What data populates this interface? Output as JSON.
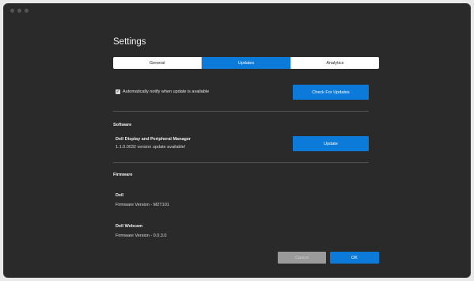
{
  "dialog": {
    "title": "Settings"
  },
  "tabs": [
    {
      "label": "General",
      "active": false
    },
    {
      "label": "Updates",
      "active": true
    },
    {
      "label": "Analytics",
      "active": false
    }
  ],
  "updates": {
    "auto_notify_label": "Automatically notify when update is available",
    "auto_notify_checked": true,
    "check_button": "Check For Updates"
  },
  "software": {
    "heading": "Software",
    "app_name": "Dell Display and Peripheral Manager",
    "status": "1.1.0.0032 version update available!",
    "update_button": "Update"
  },
  "firmware": {
    "heading": "Firmware",
    "devices": [
      {
        "name": "Dell",
        "version": "Firmware Version - M2T101"
      },
      {
        "name": "Dell Webcam",
        "version": "Firmware Version - 0.0.3.0"
      }
    ]
  },
  "footer": {
    "cancel_label": "Cancel",
    "ok_label": "OK"
  },
  "colors": {
    "accent": "#0b7ad9",
    "background": "#2a2a2a",
    "disabled": "#9a9a9a"
  },
  "icons": {
    "checkbox": "checkmark-icon"
  }
}
